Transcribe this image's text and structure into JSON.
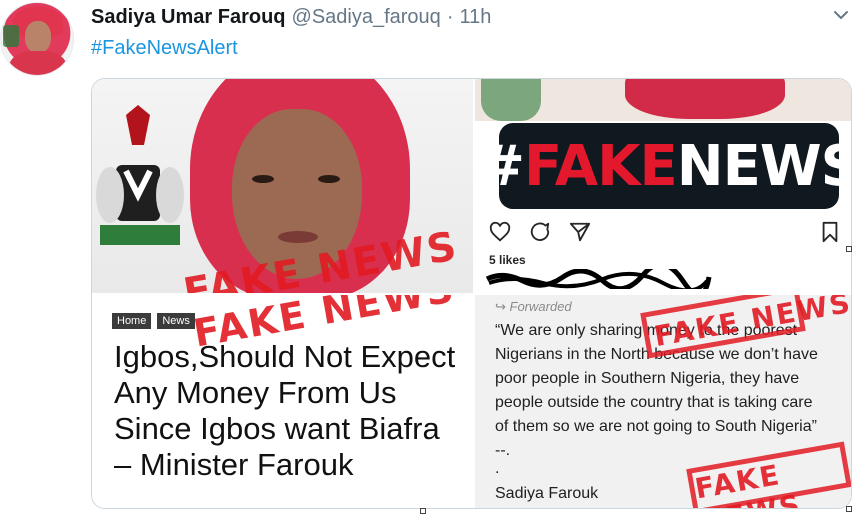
{
  "tweet": {
    "author_name": "Sadiya Umar Farouq",
    "author_handle": "@Sadiya_farouq",
    "separator": "·",
    "timestamp": "11h",
    "text": "#FakeNewsAlert"
  },
  "media": {
    "photo_stamp": "FAKE NEWS",
    "instagram": {
      "badge_hash": "#",
      "badge_fake": "FAKE",
      "badge_news": "NEWS",
      "likes": "5 likes"
    },
    "article": {
      "crumb_home": "Home",
      "crumb_news": "News",
      "stamp": "FAKE NEWS",
      "headline": "Igbos,Should Not Expect Any Money From Us Since Igbos want Biafra – Minister Farouk"
    },
    "forwarded": {
      "label": "Forwarded",
      "quote": "“We are only sharing money to the poorest Nigerians in the North because we don’t have poor people in Southern Nigeria, they have people outside the country that is taking care of them so we are not going to South Nigeria” --.",
      "dot": ".",
      "signature": "Sadiya Farouk",
      "stamp_top": "FAKE NEWS",
      "stamp_bottom": "FAKE NEWS"
    }
  },
  "colors": {
    "link": "#1b95e0",
    "stamp_red": "#e21b23",
    "badge_bg": "#101820"
  },
  "icons": [
    "chevron-down-icon",
    "heart-icon",
    "comment-icon",
    "share-icon",
    "bookmark-icon"
  ]
}
